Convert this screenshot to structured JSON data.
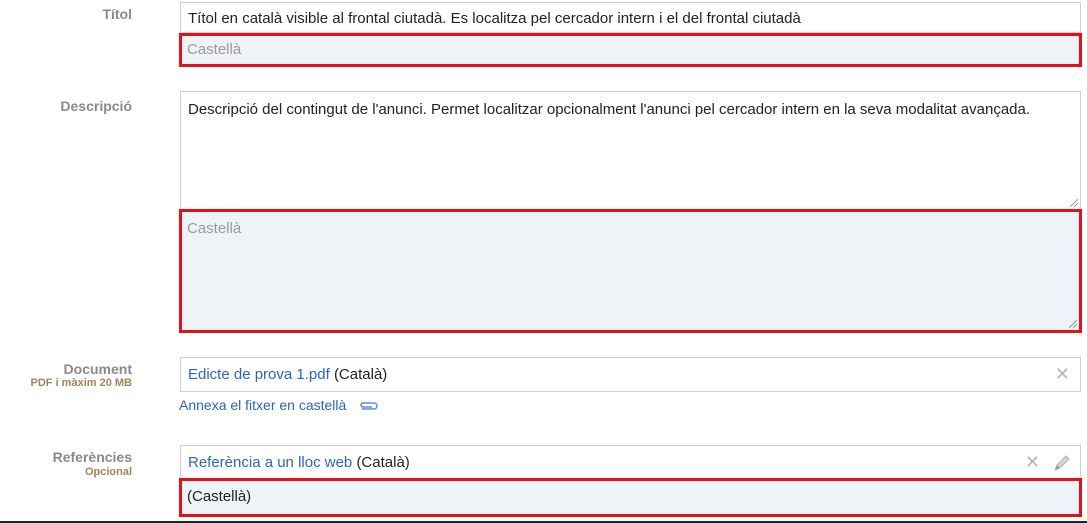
{
  "titol": {
    "label": "Títol",
    "value_ca": "Títol en català visible al frontal ciutadà. Es localitza pel cercador intern i el del frontal ciutadà",
    "placeholder_es": "Castellà"
  },
  "descripcio": {
    "label": "Descripció",
    "value_ca": "Descripció del contingut de l'anunci. Permet localitzar opcionalment l'anunci pel cercador intern en la seva modalitat avançada.",
    "placeholder_es": "Castellà"
  },
  "document": {
    "label": "Document",
    "hint": "PDF i màxim 20 MB",
    "file_name": "Edicte de prova 1.pdf",
    "file_lang": "(Català)",
    "attach_es_link": "Annexa el fitxer en castellà",
    "remove_icon": "close-icon",
    "attach_icon": "paperclip-icon"
  },
  "referencies": {
    "label": "Referències",
    "hint": "Opcional",
    "link_text": "Referència a un lloc web",
    "link_lang": "(Català)",
    "es_value": "(Castellà)",
    "remove_icon": "close-icon",
    "edit_icon": "pencil-icon"
  },
  "colors": {
    "highlight": "#e0121c",
    "link": "#2a67b8",
    "es_background": "#eef3f8"
  }
}
